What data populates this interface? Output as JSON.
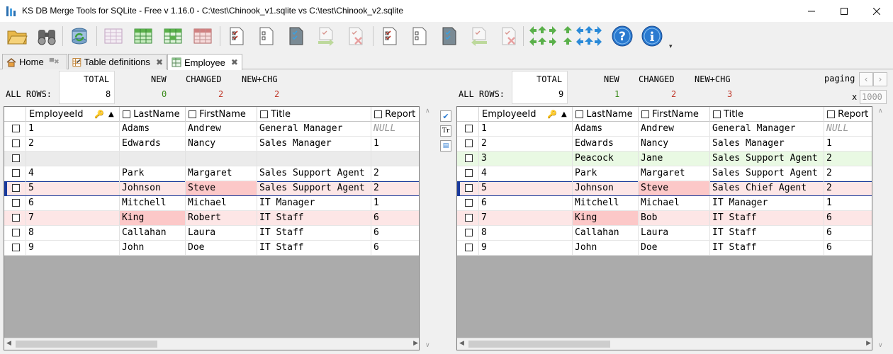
{
  "window": {
    "title": "KS DB Merge Tools for SQLite - Free v 1.16.0 - C:\\test\\Chinook_v1.sqlite vs C:\\test\\Chinook_v2.sqlite"
  },
  "tabs": [
    {
      "label": "Home",
      "icon": "home-icon"
    },
    {
      "label": "Table definitions",
      "icon": "table-definitions-icon"
    },
    {
      "label": "Employee",
      "icon": "table-icon"
    }
  ],
  "toolbar": {
    "buttons": [
      "open-icon",
      "compare-icon",
      "refresh-icon",
      "grid-all-icon",
      "grid-new-icon",
      "grid-changed-icon",
      "grid-deleted-icon",
      "check-all-icon",
      "uncheck-all-icon",
      "check-changed-icon",
      "merge-right-icon",
      "delete-right-icon",
      "check-all-right-icon",
      "uncheck-right-icon",
      "check-changed-right-icon",
      "merge-left-icon",
      "delete-left-icon",
      "navigation-arrows-icon",
      "help-icon",
      "info-icon"
    ]
  },
  "summary_labels": {
    "all_rows": "ALL ROWS:",
    "total": "TOTAL",
    "new": "NEW",
    "changed": "CHANGED",
    "new_chg": "NEW+CHG"
  },
  "left": {
    "total": "8",
    "new": "0",
    "changed": "2",
    "new_chg": "2",
    "columns": [
      "EmployeeId",
      "LastName",
      "FirstName",
      "Title",
      "Report"
    ],
    "rows": [
      {
        "id": "1",
        "last": "Adams",
        "first": "Andrew",
        "title": "General Manager",
        "report": "NULL"
      },
      {
        "id": "2",
        "last": "Edwards",
        "first": "Nancy",
        "title": "Sales Manager",
        "report": "1"
      },
      {
        "id": "",
        "last": "",
        "first": "",
        "title": "",
        "report": ""
      },
      {
        "id": "4",
        "last": "Park",
        "first": "Margaret",
        "title": "Sales Support Agent",
        "report": "2"
      },
      {
        "id": "5",
        "last": "Johnson",
        "first": "Steve",
        "title": "Sales Support Agent",
        "report": "2"
      },
      {
        "id": "6",
        "last": "Mitchell",
        "first": "Michael",
        "title": "IT Manager",
        "report": "1"
      },
      {
        "id": "7",
        "last": "King",
        "first": "Robert",
        "title": "IT Staff",
        "report": "6"
      },
      {
        "id": "8",
        "last": "Callahan",
        "first": "Laura",
        "title": "IT Staff",
        "report": "6"
      },
      {
        "id": "9",
        "last": "John",
        "first": "Doe",
        "title": "IT Staff",
        "report": "6"
      }
    ]
  },
  "right": {
    "total": "9",
    "new": "1",
    "changed": "2",
    "new_chg": "3",
    "columns": [
      "EmployeeId",
      "LastName",
      "FirstName",
      "Title",
      "Report"
    ],
    "rows": [
      {
        "id": "1",
        "last": "Adams",
        "first": "Andrew",
        "title": "General Manager",
        "report": "NULL"
      },
      {
        "id": "2",
        "last": "Edwards",
        "first": "Nancy",
        "title": "Sales Manager",
        "report": "1"
      },
      {
        "id": "3",
        "last": "Peacock",
        "first": "Jane",
        "title": "Sales Support Agent",
        "report": "2"
      },
      {
        "id": "4",
        "last": "Park",
        "first": "Margaret",
        "title": "Sales Support Agent",
        "report": "2"
      },
      {
        "id": "5",
        "last": "Johnson",
        "first": "Steve",
        "title": "Sales Chief Agent",
        "report": "2"
      },
      {
        "id": "6",
        "last": "Mitchell",
        "first": "Michael",
        "title": "IT Manager",
        "report": "1"
      },
      {
        "id": "7",
        "last": "King",
        "first": "Bob",
        "title": "IT Staff",
        "report": "6"
      },
      {
        "id": "8",
        "last": "Callahan",
        "first": "Laura",
        "title": "IT Staff",
        "report": "6"
      },
      {
        "id": "9",
        "last": "John",
        "first": "Doe",
        "title": "IT Staff",
        "report": "6"
      }
    ]
  },
  "paging": {
    "label": "paging",
    "x_label": "x",
    "page_size": "1000"
  },
  "colors": {
    "new_row": "#e9f9e3",
    "changed_row": "#fde6e6",
    "changed_cell": "#fcc8c8",
    "new_count": "#3a8a1a",
    "changed_count": "#c0392b",
    "selection": "#1a3a9c"
  }
}
